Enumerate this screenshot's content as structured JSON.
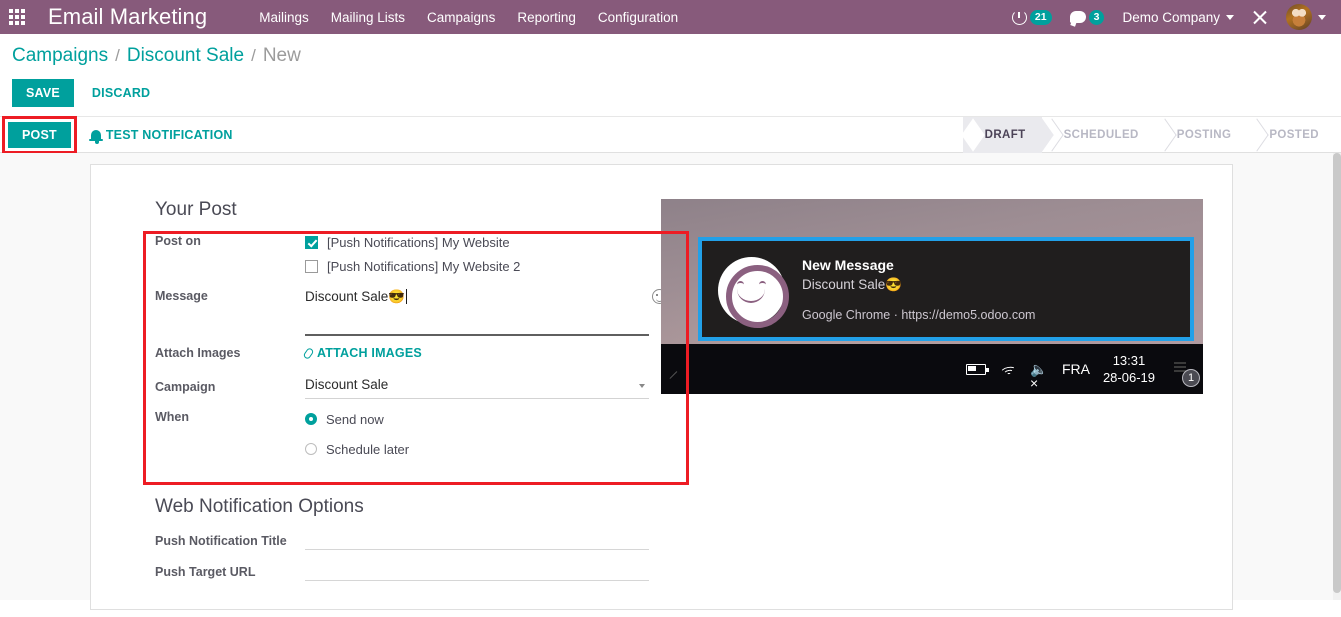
{
  "navbar": {
    "apps_icon": "apps-grid-icon",
    "brand": "Email Marketing",
    "menu": [
      {
        "label": "Mailings"
      },
      {
        "label": "Mailing Lists"
      },
      {
        "label": "Campaigns"
      },
      {
        "label": "Reporting"
      },
      {
        "label": "Configuration"
      }
    ],
    "activity": {
      "icon": "clock-icon",
      "count": "21"
    },
    "messages": {
      "icon": "chat-icon",
      "count": "3"
    },
    "company": "Demo Company",
    "tools_icon": "tools-icon",
    "avatar_icon": "user-avatar"
  },
  "breadcrumb": {
    "root": "Campaigns",
    "sep": "/",
    "parent": "Discount Sale",
    "current": "New"
  },
  "control_panel": {
    "save_label": "SAVE",
    "discard_label": "DISCARD"
  },
  "sheet_header": {
    "post_label": "POST",
    "test_label": "TEST NOTIFICATION",
    "bell_icon": "bell-icon",
    "stages": [
      {
        "label": "DRAFT",
        "active": true
      },
      {
        "label": "SCHEDULED",
        "active": false
      },
      {
        "label": "POSTING",
        "active": false
      },
      {
        "label": "POSTED",
        "active": false
      }
    ]
  },
  "form": {
    "title": "Your Post",
    "post_on": {
      "label": "Post on",
      "options": [
        {
          "label": "[Push Notifications] My Website",
          "checked": true
        },
        {
          "label": "[Push Notifications] My Website 2",
          "checked": false
        }
      ]
    },
    "message": {
      "label": "Message",
      "value": "Discount Sale😎",
      "emoji_picker_icon": "smiley-icon"
    },
    "attach_images": {
      "label": "Attach Images",
      "button_label": "ATTACH IMAGES",
      "clip_icon": "paperclip-icon"
    },
    "campaign": {
      "label": "Campaign",
      "value": "Discount Sale",
      "caret_icon": "chevron-down-icon",
      "external_icon": "external-link-icon"
    },
    "when": {
      "label": "When",
      "options": [
        {
          "label": "Send now",
          "selected": true
        },
        {
          "label": "Schedule later",
          "selected": false
        }
      ]
    }
  },
  "section2": {
    "title": "Web Notification Options",
    "fields": [
      {
        "label": "Push Notification Title",
        "value": ""
      },
      {
        "label": "Push Target URL",
        "value": ""
      }
    ]
  },
  "preview": {
    "toast": {
      "title": "New Message",
      "subtitle": "Discount Sale😎",
      "source": "Google Chrome · https://demo5.odoo.com",
      "avatar_icon": "smiley-avatar-icon"
    },
    "taskbar": {
      "battery_icon": "battery-icon",
      "wifi_icon": "wifi-icon",
      "speaker_icon": "speaker-muted-icon",
      "language": "FRA",
      "time": "13:31",
      "date": "28-06-19",
      "notification_icon": "notification-center-icon",
      "notification_count": "1"
    }
  },
  "colors": {
    "brand_purple": "#875A7B",
    "accent_teal": "#00A09D",
    "highlight_red": "#ED1C24",
    "toast_outline_blue": "#22A0E8"
  }
}
